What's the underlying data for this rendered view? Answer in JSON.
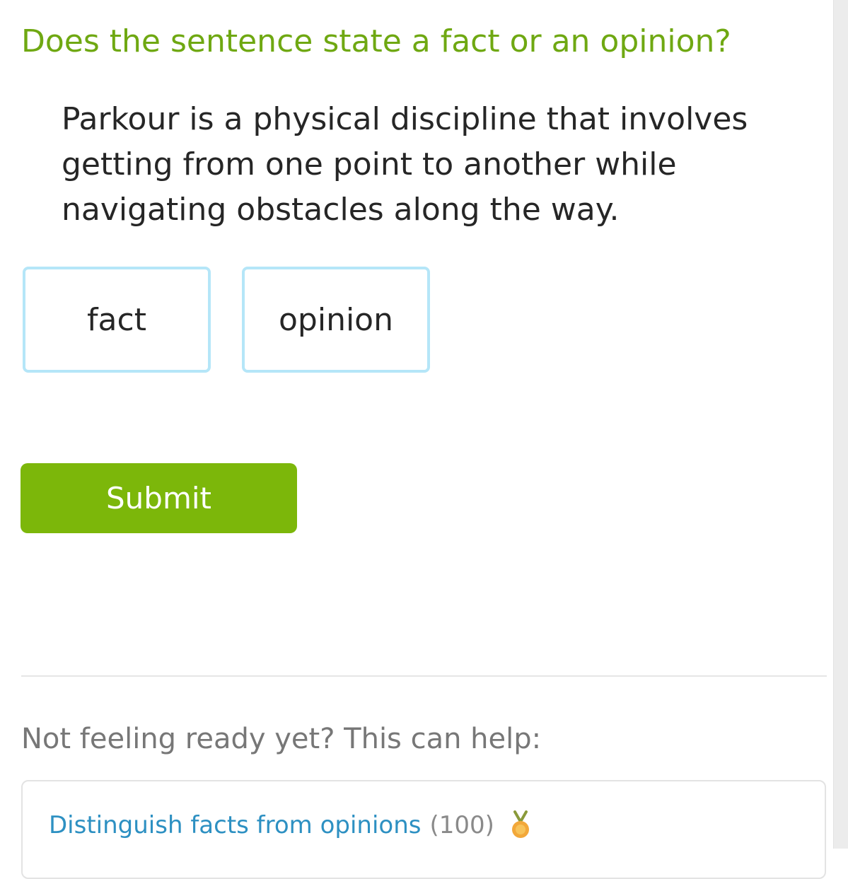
{
  "question": "Does the sentence state a fact or an opinion?",
  "sentence": "Parkour is a physical discipline that involves getting from one point to another while navigating obstacles along the way.",
  "choices": [
    {
      "label": "fact"
    },
    {
      "label": "opinion"
    }
  ],
  "submit_label": "Submit",
  "help": {
    "prompt": "Not feeling ready yet? This can help:",
    "skill_name": "Distinguish facts from opinions",
    "skill_score": "(100)",
    "medal_icon": "medal-icon"
  },
  "colors": {
    "question": "#6fa812",
    "choice_border": "#b5e6f8",
    "submit_bg": "#7cb70a",
    "link": "#2d90c2",
    "medal": "#f2a83a"
  }
}
